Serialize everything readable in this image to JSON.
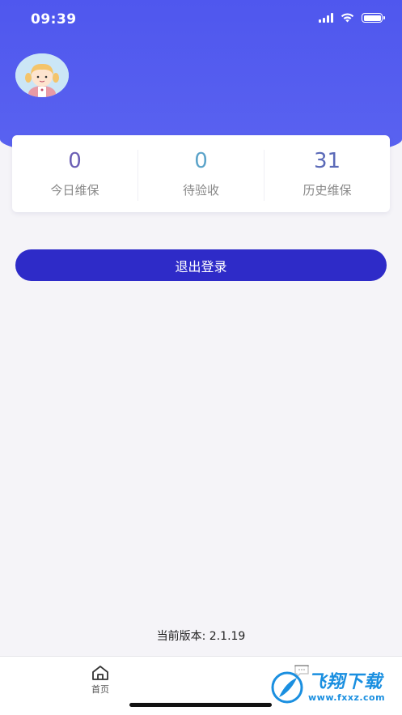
{
  "status_bar": {
    "time": "09:39"
  },
  "profile": {
    "avatar_icon": "girl-avatar-icon"
  },
  "stats": [
    {
      "value": "0",
      "label": "今日维保",
      "color": "#6b5fb5"
    },
    {
      "value": "0",
      "label": "待验收",
      "color": "#5ba3c9"
    },
    {
      "value": "31",
      "label": "历史维保",
      "color": "#5b6ab8"
    }
  ],
  "actions": {
    "logout_label": "退出登录"
  },
  "footer": {
    "version_text": "当前版本: 2.1.19"
  },
  "tab_bar": {
    "items": [
      {
        "label": "首页",
        "icon": "home-icon"
      },
      {
        "label": "",
        "icon": "chat-icon"
      }
    ]
  },
  "watermark": {
    "title": "飞翔下载",
    "url": "www.fxxz.com"
  },
  "colors": {
    "header_gradient_top": "#4f57ee",
    "button_bg": "#2e2bc8",
    "page_bg": "#f5f4f8"
  }
}
